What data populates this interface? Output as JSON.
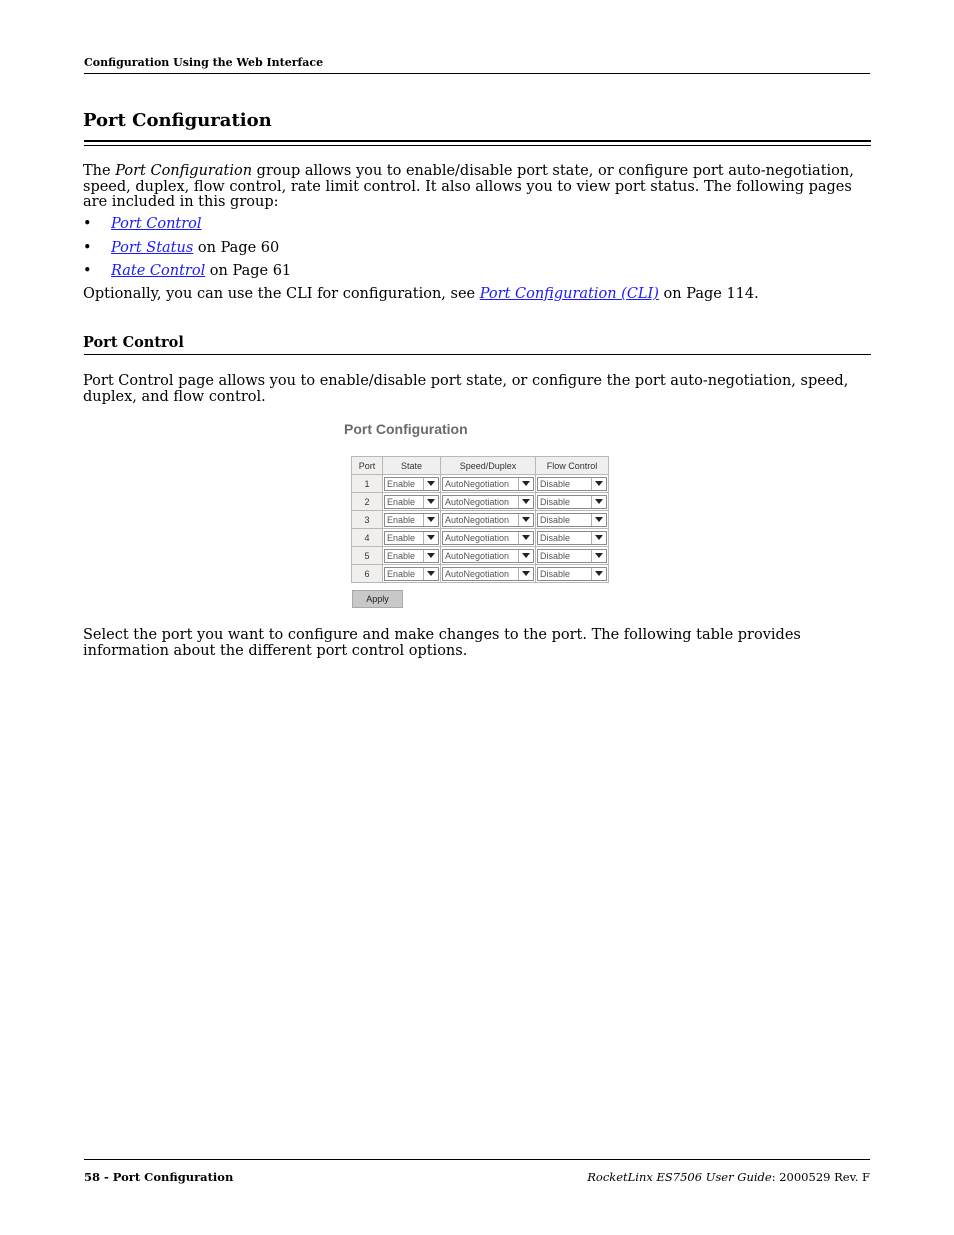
{
  "header": {
    "running_title": "Configuration Using the Web Interface"
  },
  "section": {
    "title": "Port Configuration",
    "intro": {
      "prefix": "The ",
      "italic": "Port Configuration",
      "rest": " group allows you to enable/disable port state, or configure port auto-negotiation, speed, duplex, flow control,  rate limit control. It also allows you to view port status. The following pages are included in this group:"
    },
    "bullets": [
      {
        "link": "Port Control",
        "suffix": ""
      },
      {
        "link": "Port Status",
        "suffix": " on Page 60"
      },
      {
        "link": "Rate Control",
        "suffix": " on Page 61"
      }
    ],
    "cli_note": {
      "prefix": "Optionally, you can use the CLI for configuration, see ",
      "link": "Port Configuration (CLI)",
      "suffix": " on Page 114."
    }
  },
  "subsection": {
    "title": "Port Control",
    "description": "Port Control page allows you to enable/disable port state, or configure the port auto-negotiation, speed, duplex, and flow control.",
    "after_figure": "Select the port you want to configure and make changes to the port. The following table provides information about the different port control options."
  },
  "figure": {
    "title": "Port Configuration",
    "columns": [
      "Port",
      "State",
      "Speed/Duplex",
      "Flow Control"
    ],
    "rows": [
      {
        "port": "1",
        "state": "Enable",
        "speed": "AutoNegotiation",
        "flow": "Disable"
      },
      {
        "port": "2",
        "state": "Enable",
        "speed": "AutoNegotiation",
        "flow": "Disable"
      },
      {
        "port": "3",
        "state": "Enable",
        "speed": "AutoNegotiation",
        "flow": "Disable"
      },
      {
        "port": "4",
        "state": "Enable",
        "speed": "AutoNegotiation",
        "flow": "Disable"
      },
      {
        "port": "5",
        "state": "Enable",
        "speed": "AutoNegotiation",
        "flow": "Disable"
      },
      {
        "port": "6",
        "state": "Enable",
        "speed": "AutoNegotiation",
        "flow": "Disable"
      }
    ],
    "apply_label": "Apply"
  },
  "footer": {
    "left": "58 - Port Configuration",
    "right_italic": "RocketLinx ES7506  User Guide",
    "right_rest": ": 2000529 Rev. F"
  },
  "colors": {
    "link": "#1a1aff",
    "figure_title": "#6b6b6b",
    "table_header_bg": "#f0efed",
    "apply_bg": "#c8c8c8"
  }
}
